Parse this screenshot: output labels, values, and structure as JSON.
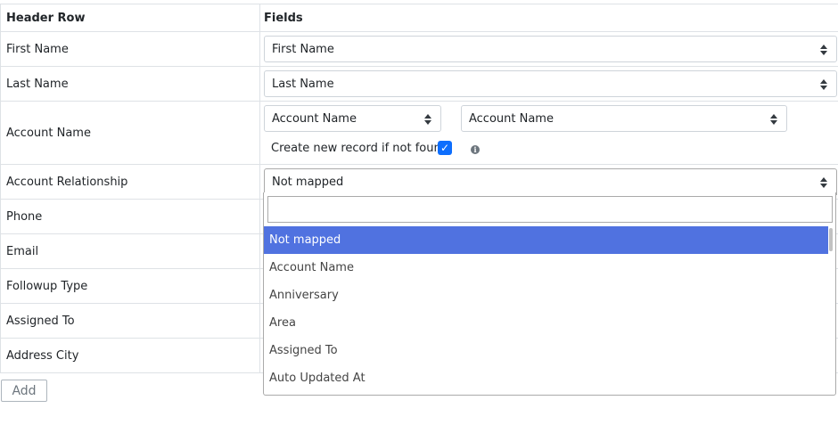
{
  "table": {
    "header": {
      "col1": "Header Row",
      "col2": "Fields"
    },
    "rows": [
      {
        "label": "First Name",
        "field": "First Name"
      },
      {
        "label": "Last Name",
        "field": "Last Name"
      },
      {
        "label": "Account Name",
        "field_a": "Account Name",
        "field_b": "Account Name",
        "create_label": "Create new record if not found",
        "create_checked": true
      },
      {
        "label": "Account Relationship",
        "field": "Not mapped"
      },
      {
        "label": "Phone"
      },
      {
        "label": "Email"
      },
      {
        "label": "Followup Type"
      },
      {
        "label": "Assigned To"
      },
      {
        "label": "Address City"
      }
    ]
  },
  "dropdown": {
    "search_value": "",
    "options": [
      "Not mapped",
      "Account Name",
      "Anniversary",
      "Area",
      "Assigned To",
      "Auto Updated At"
    ],
    "selected_index": 0
  },
  "add_button": {
    "label": "Add"
  },
  "icons": {
    "info": "info-circle-icon",
    "check": "checkmark-icon",
    "select_arrows": "sort-arrows-icon"
  },
  "colors": {
    "checkbox": "#0d6efd",
    "selected_option": "#5072e0",
    "border": "#dee2e6"
  }
}
